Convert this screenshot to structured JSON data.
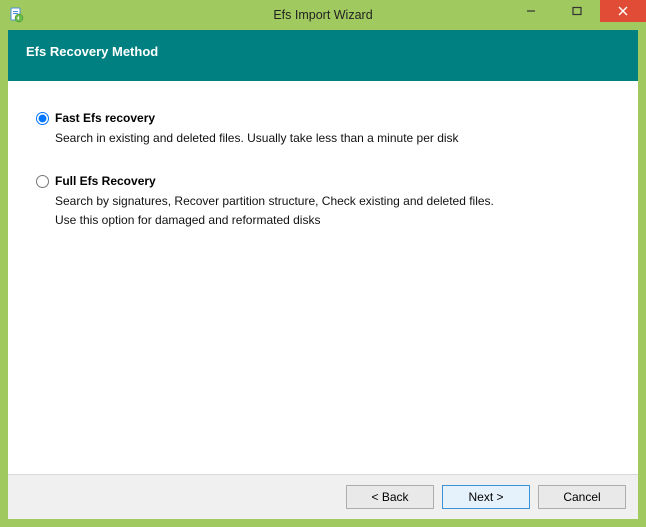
{
  "window": {
    "title": "Efs Import Wizard"
  },
  "header": {
    "title": "Efs Recovery Method"
  },
  "options": {
    "fast": {
      "label": "Fast Efs recovery",
      "desc": "Search in existing and deleted files. Usually take less than a minute per disk"
    },
    "full": {
      "label": "Full Efs Recovery",
      "desc1": "Search by signatures, Recover partition structure, Check existing and deleted files.",
      "desc2": "Use this option for damaged and reformated disks"
    },
    "selected": "fast"
  },
  "footer": {
    "back": "< Back",
    "next": "Next >",
    "cancel": "Cancel"
  }
}
